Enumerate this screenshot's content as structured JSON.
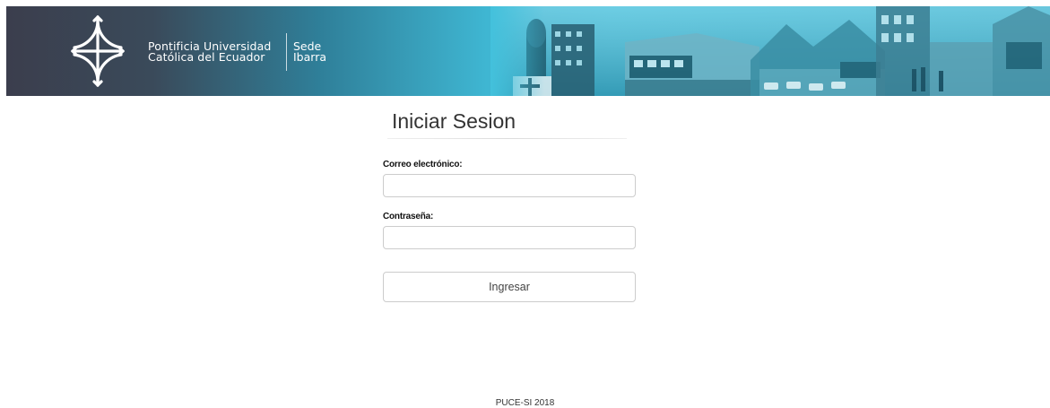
{
  "header": {
    "brand_line1": "Pontificia Universidad",
    "brand_line2": "Católica del Ecuador",
    "sede_line1": "Sede",
    "sede_line2": "Ibarra",
    "logo_icon": "cross-emblem-icon",
    "banner_image": "campus-photo-collage",
    "colors": {
      "dark": "#3b3e4d",
      "teal": "#43c1dc"
    }
  },
  "login": {
    "title": "Iniciar Sesion",
    "email_label": "Correo electrónico:",
    "email_value": "",
    "password_label": "Contraseña:",
    "password_value": "",
    "submit_label": "Ingresar"
  },
  "footer": {
    "text": "PUCE-SI 2018"
  }
}
